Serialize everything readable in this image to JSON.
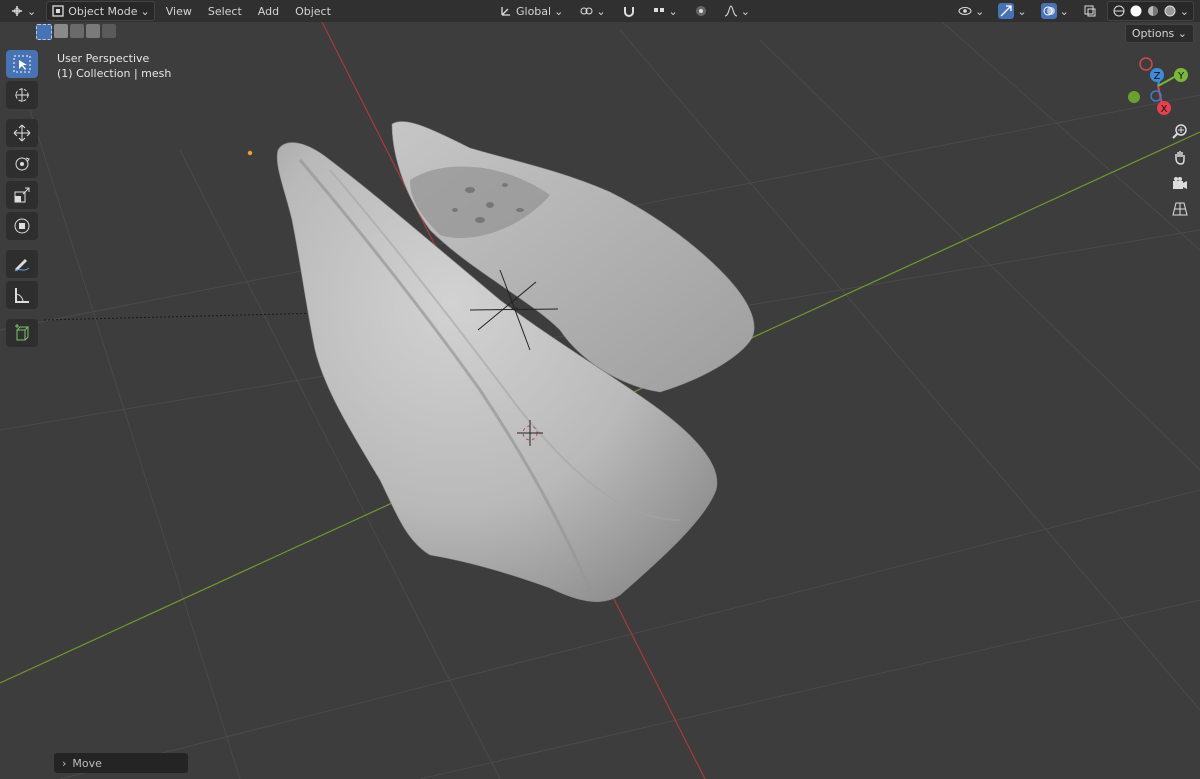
{
  "header": {
    "mode_label": "Object Mode",
    "menus": [
      "View",
      "Select",
      "Add",
      "Object"
    ],
    "orientation_label": "Global",
    "options_label": "Options"
  },
  "overlay": {
    "view_name": "User Perspective",
    "collection_info": "(1) Collection | mesh"
  },
  "gizmo": {
    "z_label": "Z",
    "y_label": "Y",
    "x_label": "X",
    "colors": {
      "x": "#e5404f",
      "y": "#7ab83a",
      "z": "#3f8bd8"
    }
  },
  "toolbar": {
    "tools": [
      "select-box",
      "cursor",
      "move",
      "rotate",
      "scale",
      "transform",
      "annotate",
      "measure",
      "add-cube"
    ],
    "active": "select-box"
  },
  "last_operator": {
    "label": "Move"
  },
  "colors": {
    "viewport_bg": "#3c3c3c",
    "header_bg": "#303030",
    "accent": "#4772b3",
    "x_axis": "#b33a3a",
    "y_axis": "#6a9a2a",
    "mesh": "#bdbdbd"
  }
}
